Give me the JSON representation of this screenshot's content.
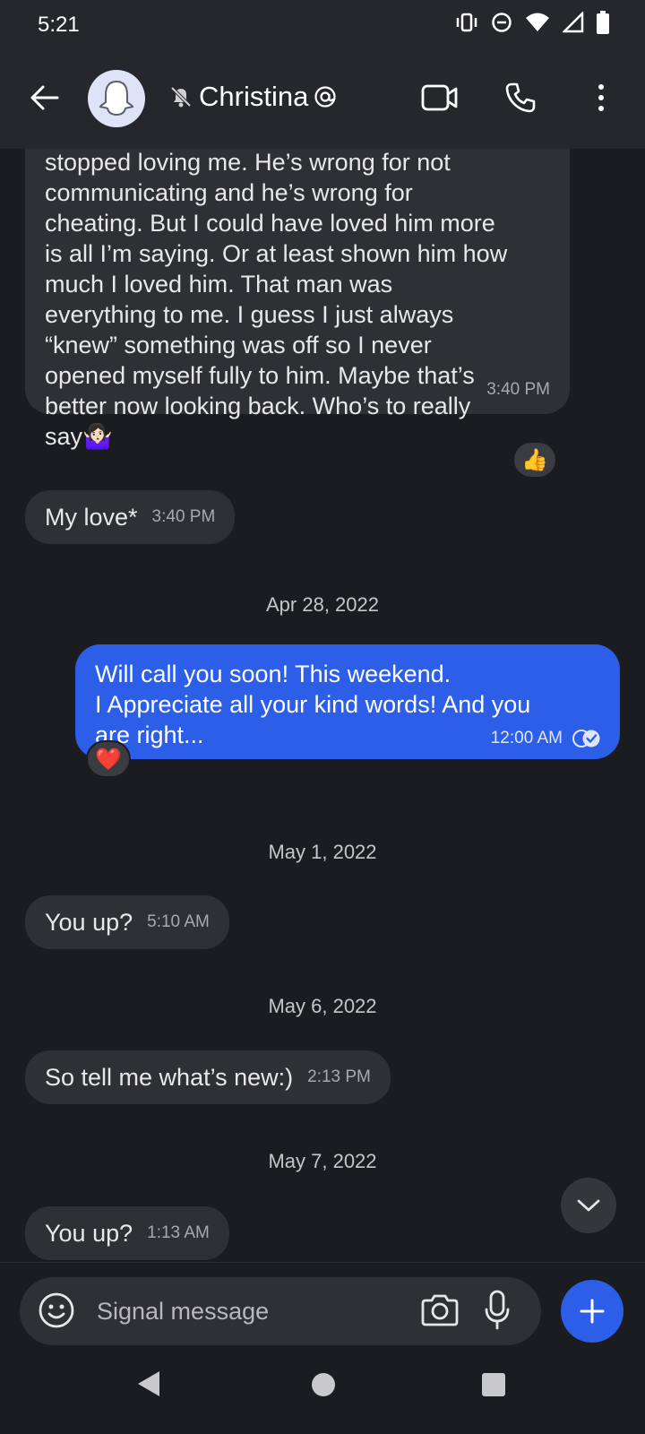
{
  "status_bar": {
    "time": "5:21"
  },
  "header": {
    "contact_name": "Christina",
    "icons": [
      "back-arrow-icon",
      "ghost-avatar-icon",
      "muted-bell-icon",
      "at-sign-icon",
      "video-call-icon",
      "phone-icon",
      "more-vertical-icon"
    ]
  },
  "messages": [
    {
      "direction": "incoming",
      "text": "stopped loving me. He’s wrong for not\ncommunicating and he’s wrong for\ncheating. But I could have loved him more\nis all I’m saying. Or at least shown him how\nmuch I loved him. That man was\neverything to me. I guess I just always\n“knew” something was off so I never\nopened myself fully to him. Maybe that’s\nbetter now looking back. Who’s to really\nsay🤷🏻‍♀️",
      "time": "3:40 PM",
      "reaction": "👍"
    },
    {
      "direction": "incoming",
      "text": "My love*",
      "time": "3:40 PM"
    },
    {
      "direction": "divider",
      "text": "Apr 28, 2022"
    },
    {
      "direction": "outgoing",
      "text": "Will call you soon! This weekend.\nI Appreciate all your kind words! And you\nare right...",
      "time": "12:00 AM",
      "status": "read",
      "reaction": "❤️"
    },
    {
      "direction": "divider",
      "text": "May 1, 2022"
    },
    {
      "direction": "incoming",
      "text": "You up?",
      "time": "5:10 AM"
    },
    {
      "direction": "divider",
      "text": "May 6, 2022"
    },
    {
      "direction": "incoming",
      "text": "So tell me what’s new:)",
      "time": "2:13 PM"
    },
    {
      "direction": "divider",
      "text": "May 7, 2022"
    },
    {
      "direction": "incoming",
      "text": "You up?",
      "time": "1:13 AM"
    }
  ],
  "composer": {
    "placeholder": "Signal message"
  },
  "colors": {
    "outgoing_bubble": "#2c5ee8",
    "incoming_bubble": "#2f3034",
    "background": "#1b1c1f"
  }
}
